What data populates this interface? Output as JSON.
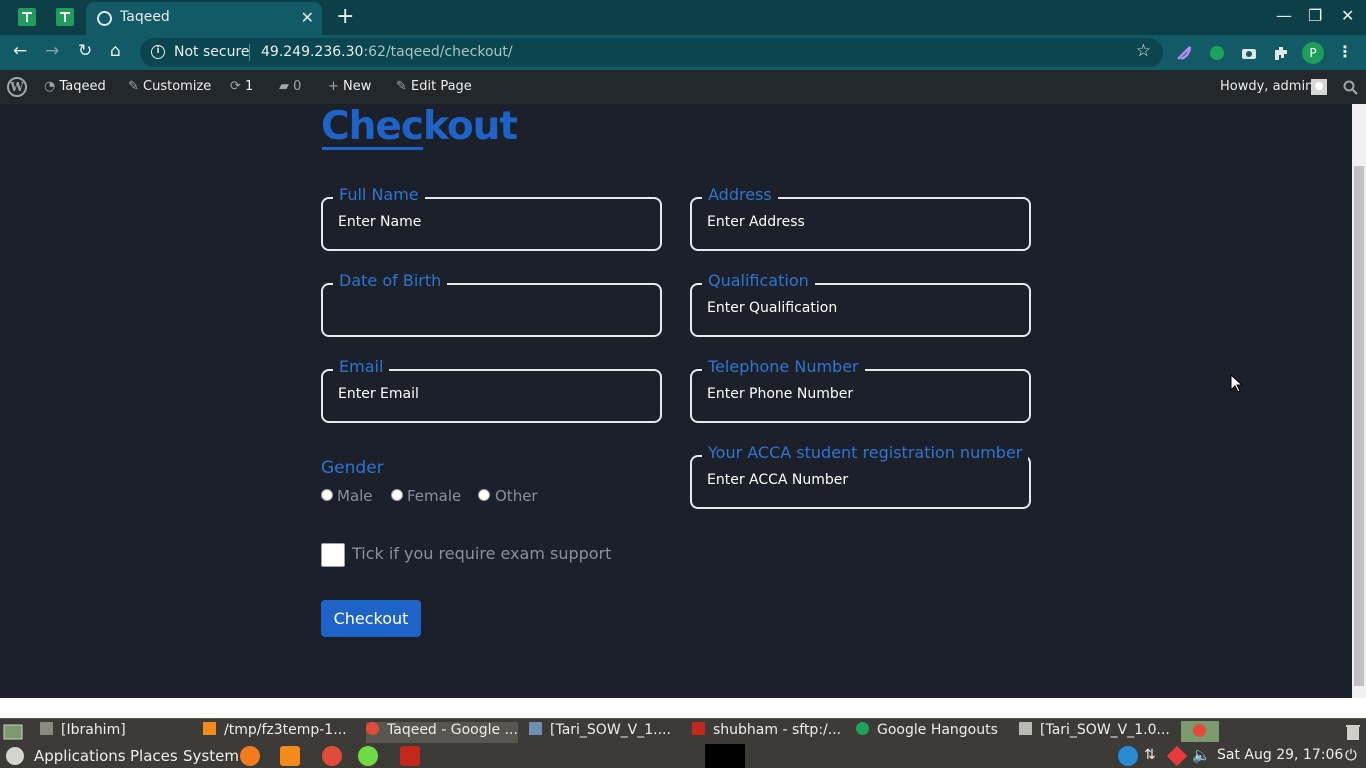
{
  "browser": {
    "tab_title": "Taqeed",
    "not_secure": "Not secure",
    "url_host": "49.249.236.30",
    "url_rest": ":62/taqeed/checkout/",
    "profile_initial": "P"
  },
  "adminbar": {
    "site_name": "Taqeed",
    "customize": "Customize",
    "updates_count": "1",
    "comments_count": "0",
    "new": "New",
    "edit_page": "Edit Page",
    "howdy": "Howdy, admin"
  },
  "page": {
    "title": "Checkout",
    "fields": {
      "full_name": {
        "label": "Full Name",
        "placeholder": "Enter Name"
      },
      "address": {
        "label": "Address",
        "placeholder": "Enter Address"
      },
      "dob": {
        "label": "Date of Birth",
        "placeholder": ""
      },
      "qualification": {
        "label": "Qualification",
        "placeholder": "Enter Qualification"
      },
      "email": {
        "label": "Email",
        "placeholder": "Enter Email"
      },
      "telephone": {
        "label": "Telephone Number",
        "placeholder": "Enter Phone Number"
      },
      "acca": {
        "label": "Your ACCA student registration number",
        "placeholder": "Enter ACCA Number"
      }
    },
    "gender": {
      "label": "Gender",
      "options": [
        "Male",
        "Female",
        "Other"
      ]
    },
    "exam_support": "Tick if you require exam support",
    "checkout_button": "Checkout",
    "colors": {
      "accent": "#1e64c8",
      "background": "#1b202b"
    }
  },
  "taskbar": {
    "windows": [
      "[Ibrahim]",
      "/tmp/fz3temp-1...",
      "Taqeed - Google ...",
      "[Tari_SOW_V_1....",
      "shubham - sftp:/...",
      "Google Hangouts",
      "[Tari_SOW_V_1.0..."
    ],
    "menus": {
      "applications": "Applications",
      "places": "Places",
      "system": "System"
    },
    "clock": "Sat Aug 29, 17:06"
  }
}
